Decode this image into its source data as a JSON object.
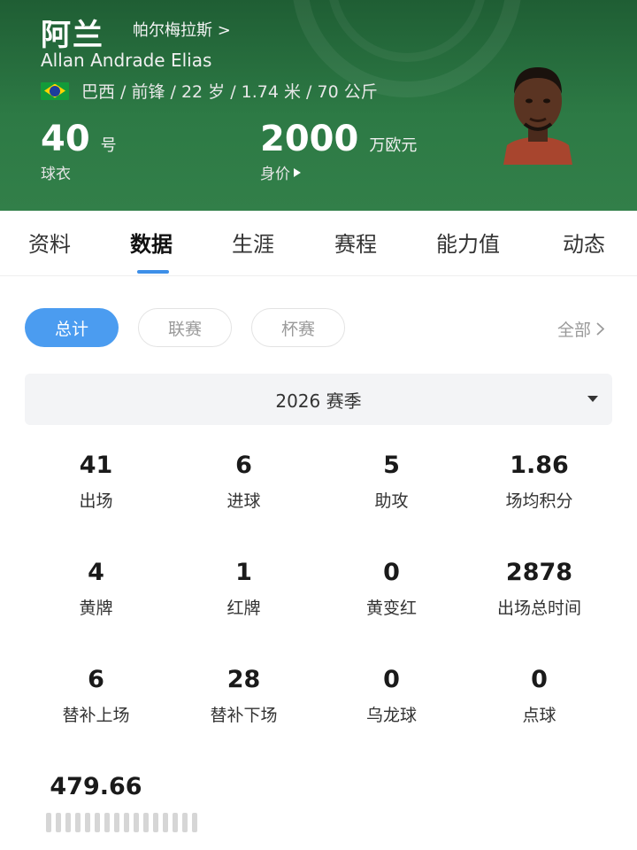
{
  "player": {
    "name_cn": "阿兰",
    "club": "帕尔梅拉斯 >",
    "name_en": "Allan Andrade Elias",
    "meta": "巴西 / 前锋 / 22 岁 / 1.74 米 / 70 公斤",
    "shirt_number": "40",
    "shirt_unit": "号",
    "shirt_caption": "球衣",
    "value": "2000",
    "value_unit": "万欧元",
    "value_caption": "身价"
  },
  "colors": {
    "header": "#2d7a45",
    "accent": "#4b9cf0"
  },
  "tabs": [
    {
      "label": "资料"
    },
    {
      "label": "数据",
      "active": true
    },
    {
      "label": "生涯"
    },
    {
      "label": "赛程"
    },
    {
      "label": "能力值"
    },
    {
      "label": "动态"
    }
  ],
  "filters": {
    "total": "总计",
    "league": "联赛",
    "cup": "杯赛",
    "all": "全部"
  },
  "season": "2026 赛季",
  "stats": [
    {
      "value": "41",
      "label": "出场"
    },
    {
      "value": "6",
      "label": "进球"
    },
    {
      "value": "5",
      "label": "助攻"
    },
    {
      "value": "1.86",
      "label": "场均积分"
    },
    {
      "value": "4",
      "label": "黄牌"
    },
    {
      "value": "1",
      "label": "红牌"
    },
    {
      "value": "0",
      "label": "黄变红"
    },
    {
      "value": "2878",
      "label": "出场总时间"
    },
    {
      "value": "6",
      "label": "替补上场"
    },
    {
      "value": "28",
      "label": "替补下场"
    },
    {
      "value": "0",
      "label": "乌龙球"
    },
    {
      "value": "0",
      "label": "点球"
    },
    {
      "value": "479.66",
      "label": ""
    }
  ]
}
